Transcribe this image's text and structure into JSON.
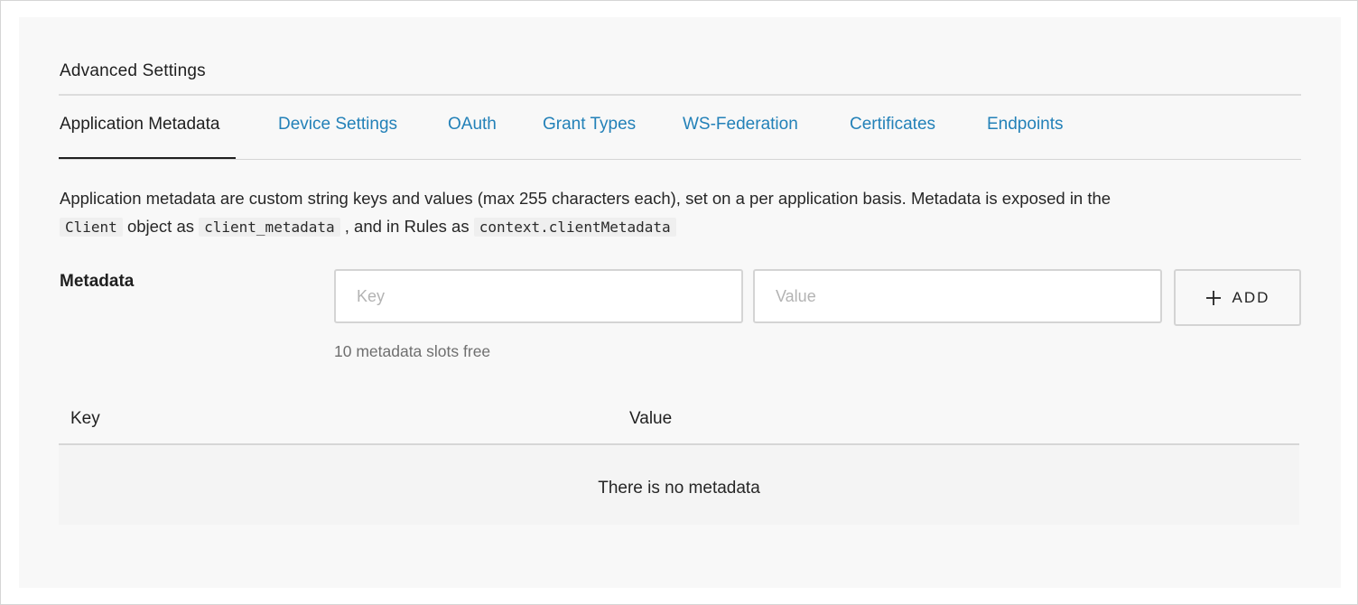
{
  "section_title": "Advanced Settings",
  "tabs": [
    {
      "label": "Application Metadata",
      "active": true
    },
    {
      "label": "Device Settings",
      "active": false
    },
    {
      "label": "OAuth",
      "active": false
    },
    {
      "label": "Grant Types",
      "active": false
    },
    {
      "label": "WS-Federation",
      "active": false
    },
    {
      "label": "Certificates",
      "active": false
    },
    {
      "label": "Endpoints",
      "active": false
    }
  ],
  "description": {
    "text_1": "Application metadata are custom string keys and values (max 255 characters each), set on a per application basis. Metadata is exposed in the",
    "code_1": "Client",
    "text_2": "object as",
    "code_2": "client_metadata",
    "text_3": ", and in Rules as",
    "code_3": "context.clientMetadata"
  },
  "metadata_form": {
    "label": "Metadata",
    "key_placeholder": "Key",
    "key_value": "",
    "value_placeholder": "Value",
    "value_value": "",
    "add_button_label": "ADD",
    "add_button_icon": "plus-icon",
    "slots_free": "10 metadata slots free"
  },
  "table": {
    "columns": [
      "Key",
      "Value"
    ],
    "rows": [],
    "empty_message": "There is no metadata"
  },
  "colors": {
    "link": "#2381b8",
    "text": "#1f1f1f",
    "panel_background": "#f8f8f8",
    "border": "#d4d4d4"
  }
}
